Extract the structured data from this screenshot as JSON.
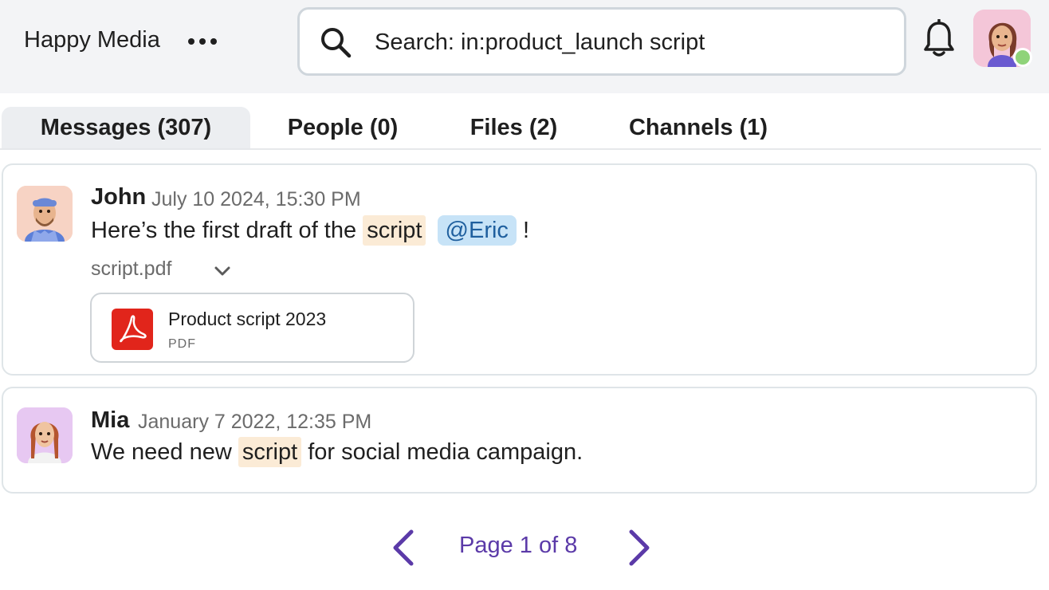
{
  "header": {
    "workspace_name": "Happy Media",
    "more_icon": "more-horizontal-icon",
    "search": {
      "value": "Search: in:product_launch script",
      "placeholder": "Search",
      "icon": "search-icon"
    },
    "notifications_icon": "bell-icon",
    "user_status": "online"
  },
  "tabs": [
    {
      "label": "Messages (307)",
      "active": true
    },
    {
      "label": "People (0)",
      "active": false
    },
    {
      "label": "Files (2)",
      "active": false
    },
    {
      "label": "Channels (1)",
      "active": false
    }
  ],
  "results": [
    {
      "author": "John",
      "timestamp": "July 10 2024, 15:30 PM",
      "text_before": "Here’s the first draft of the",
      "highlight": "script",
      "mention": "@Eric",
      "text_after": "!",
      "attachment_name": "script.pdf",
      "attachment": {
        "title": "Product script 2023",
        "type": "PDF",
        "icon": "pdf-icon"
      }
    },
    {
      "author": "Mia",
      "timestamp": "January  7 2022, 12:35 PM",
      "text_before": "We need new",
      "highlight": "script",
      "text_after": "for social media campaign."
    }
  ],
  "pagination": {
    "label": "Page 1 of 8",
    "current": 1,
    "total": 8
  },
  "colors": {
    "header_bg": "#f3f4f6",
    "highlight": "#fbebd6",
    "mention_bg": "#c7e3f7",
    "accent": "#5b3aa8",
    "pdf_red": "#e1251b",
    "presence_green": "#8fd37a"
  }
}
